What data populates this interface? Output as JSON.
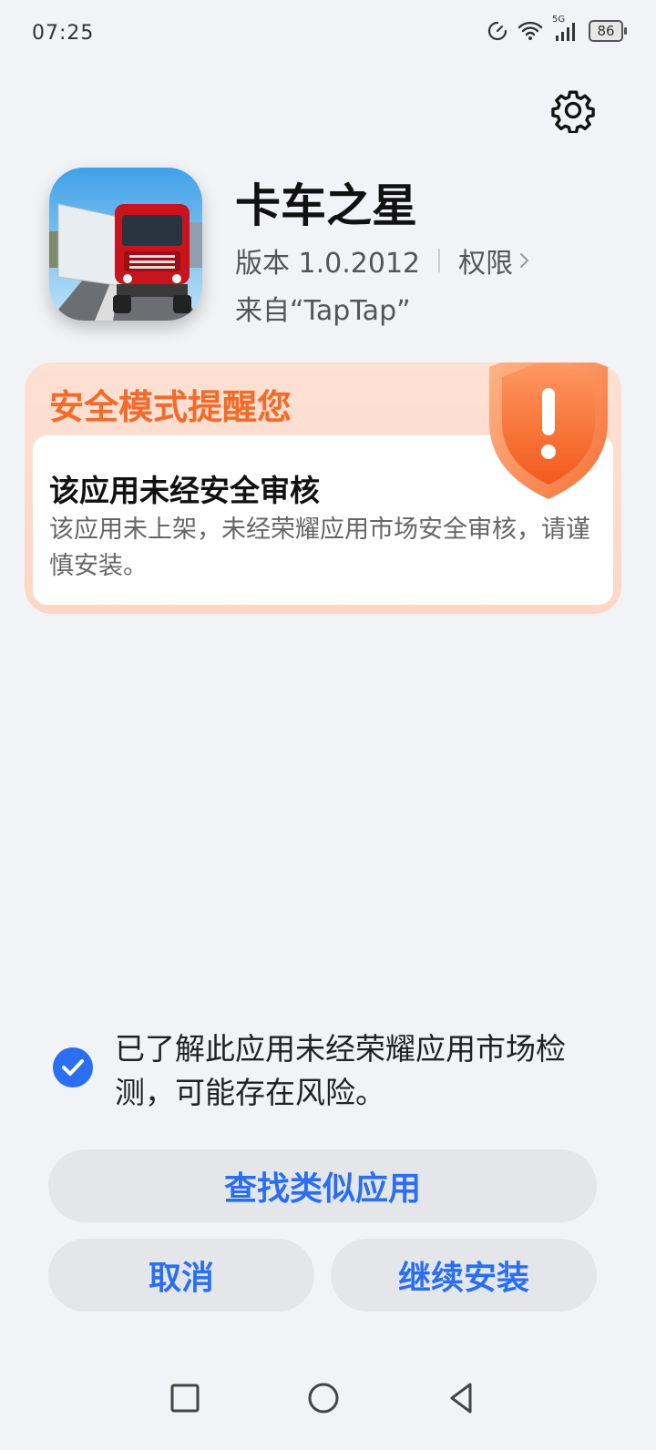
{
  "status_bar": {
    "time": "07:25",
    "network": "5G",
    "battery": "86",
    "icons": [
      "data-saver-icon",
      "wifi-icon",
      "signal-icon",
      "battery-icon"
    ]
  },
  "settings": {
    "icon": "gear-icon"
  },
  "app": {
    "name": "卡车之星",
    "version": "版本 1.0.2012",
    "permissions_label": "权限",
    "source": "来自“TapTap”",
    "icon": "truck-game-icon"
  },
  "safety_card": {
    "title": "安全模式提醒您",
    "heading": "该应用未经安全审核",
    "body": "该应用未上架，未经荣耀应用市场安全审核，请谨慎安装。",
    "icon": "warning-shield-icon",
    "colors": {
      "title": "#f26b2a",
      "background": "#fcd7c5"
    }
  },
  "acknowledgement": {
    "checked": true,
    "text": "已了解此应用未经荣耀应用市场检测，可能存在风险。"
  },
  "buttons": {
    "find_similar": "查找类似应用",
    "cancel": "取消",
    "continue_install": "继续安装"
  },
  "colors": {
    "accent": "#2a6ef2",
    "background": "#f1f3f7"
  },
  "nav": [
    "recent-apps-icon",
    "home-icon",
    "back-icon"
  ]
}
